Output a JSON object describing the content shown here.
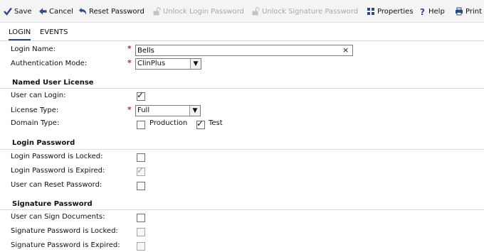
{
  "toolbar": {
    "save": "Save",
    "cancel": "Cancel",
    "reset_password": "Reset Password",
    "unlock_login_password": "Unlock Login Password",
    "unlock_signature_password": "Unlock Signature Password",
    "properties": "Properties",
    "help": "Help",
    "print": "Print"
  },
  "tabs": [
    "LOGIN",
    "EVENTS"
  ],
  "form": {
    "login_name_label": "Login Name:",
    "login_name_value": "Bells",
    "auth_mode_label": "Authentication Mode:",
    "auth_mode_value": "ClinPlus",
    "required_marker": "*"
  },
  "named_user_license": {
    "title": "Named User License",
    "can_login_label": "User can Login:",
    "can_login": true,
    "license_type_label": "License Type:",
    "license_type_value": "Full",
    "domain_type_label": "Domain Type:",
    "domain_production_label": "Production",
    "domain_production": false,
    "domain_test_label": "Test",
    "domain_test": true
  },
  "login_password": {
    "title": "Login Password",
    "locked_label": "Login Password is Locked:",
    "locked": false,
    "expired_label": "Login Password is Expired:",
    "expired": true,
    "can_reset_label": "User can Reset Password:",
    "can_reset": false
  },
  "signature_password": {
    "title": "Signature Password",
    "can_sign_label": "User can Sign Documents:",
    "can_sign": false,
    "locked_label": "Signature Password is Locked:",
    "locked": false,
    "expired_label": "Signature Password is Expired:",
    "expired": false
  },
  "colors": {
    "accent": "#2b4a8a",
    "required": "#e01b1b",
    "disabled": "#a9a9a9"
  }
}
